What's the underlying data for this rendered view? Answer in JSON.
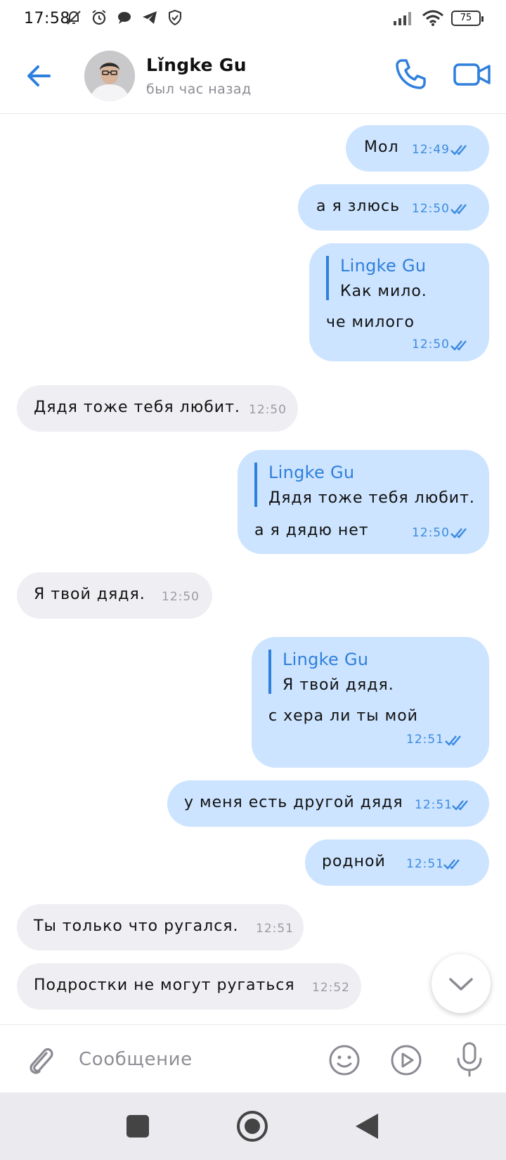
{
  "status_bar": {
    "time": "17:58",
    "battery": "75"
  },
  "header": {
    "contact_name": "Lǐngke Gu",
    "contact_status": "был час назад"
  },
  "messages": [
    {
      "dir": "out",
      "text": "Мол",
      "time": "12:49"
    },
    {
      "dir": "out",
      "text": "а я злюсь",
      "time": "12:50"
    },
    {
      "dir": "out",
      "reply_author": "Lingke Gu",
      "reply_text": "Как мило.",
      "text": "че милого",
      "time": "12:50"
    },
    {
      "dir": "in",
      "text": "Дядя тоже тебя любит.",
      "time": "12:50"
    },
    {
      "dir": "out",
      "reply_author": "Lingke Gu",
      "reply_text": "Дядя тоже тебя любит.",
      "text": "а я дядю нет",
      "time": "12:50"
    },
    {
      "dir": "in",
      "text": "Я твой дядя.",
      "time": "12:50"
    },
    {
      "dir": "out",
      "reply_author": "Lingke Gu",
      "reply_text": "Я твой дядя.",
      "text": "с хера ли ты мой",
      "time": "12:51"
    },
    {
      "dir": "out",
      "text": "у меня есть другой дядя",
      "time": "12:51"
    },
    {
      "dir": "out",
      "text": "родной",
      "time": "12:51"
    },
    {
      "dir": "in",
      "text": "Ты только что ругался.",
      "time": "12:51"
    },
    {
      "dir": "in",
      "text": "Подростки не могут ругаться",
      "time": "12:52"
    }
  ],
  "composer": {
    "placeholder": "Сообщение"
  },
  "colors": {
    "accent": "#2f7fdc",
    "outgoing_bubble": "#cce4ff",
    "incoming_bubble": "#efeff3"
  },
  "icons": [
    "back-arrow-icon",
    "phone-icon",
    "video-camera-icon",
    "paperclip-icon",
    "emoji-icon",
    "play-icon",
    "microphone-icon",
    "chevron-down-icon",
    "double-check-icon"
  ]
}
